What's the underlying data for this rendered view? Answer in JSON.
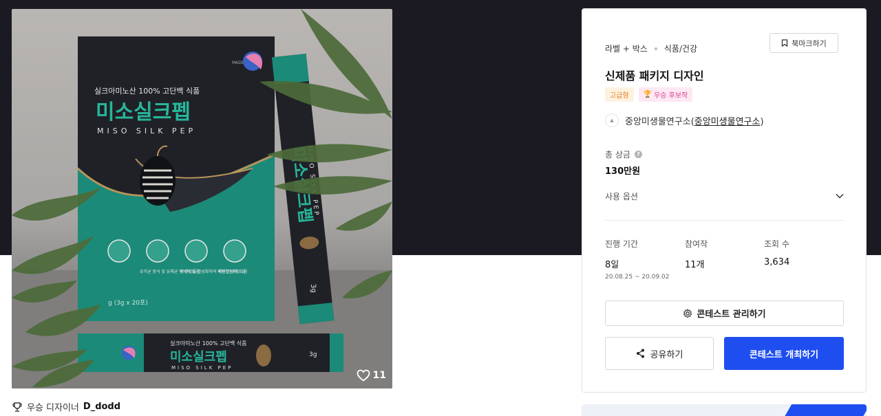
{
  "product_image": {
    "brand_mark": "MADEVINN",
    "tagline": "실크아미노산 100% 고단백 식품",
    "product_name_kr": "미소실크펩",
    "product_name_en": "MISO SILK PEP",
    "stick_tagline": "실크아미노산 100% 고단백 식품",
    "stick_name_kr": "미소실크펩",
    "stick_name_en": "MISO SILK PEP",
    "stick_weight": "3g",
    "weight_note": "g (3g x 20포)",
    "benefits": [
      "유익균 증식 및 유해균 억제에 도움",
      "장 건강을 활성화하여 배변활동에 도움",
      "피부 건강에 도움"
    ],
    "likes": "11"
  },
  "winner": {
    "prefix": "우승 디자이너",
    "name": "D_dodd"
  },
  "panel": {
    "category_1": "라벨 + 박스",
    "category_2": "식품/건강",
    "bookmark_label": "북마크하기",
    "title": "신제품 패키지 디자인",
    "badge_grade": "고급형",
    "badge_winner": "우승 후보작",
    "host_name": "중앙미생물연구소",
    "host_link": "중앙미생물연구소",
    "prize_label": "총 상금",
    "prize_value": "130만원",
    "usage_label": "사용 옵션",
    "stats": {
      "period_label": "진행 기간",
      "period_value": "8일",
      "period_range": "20.08.25 ~ 20.09.02",
      "entries_label": "참여작",
      "entries_value": "11개",
      "views_label": "조회 수",
      "views_value": "3,634"
    },
    "manage_label": "콘테스트 관리하기",
    "share_label": "공유하기",
    "open_label": "콘테스트 개최하기"
  },
  "colors": {
    "hero": "#1b1a22",
    "primary": "#1e4ef0",
    "package_dark": "#1f2127",
    "package_teal": "#1c8a78",
    "package_gold": "#b8935a"
  }
}
